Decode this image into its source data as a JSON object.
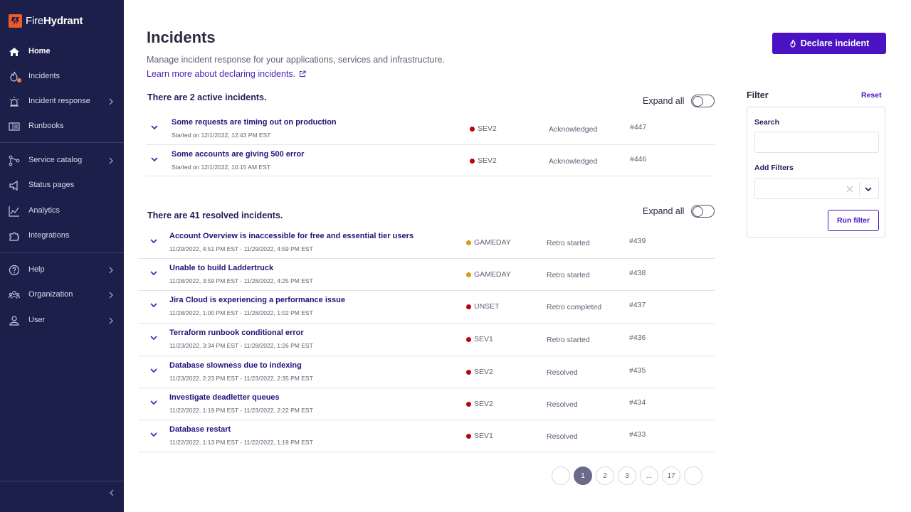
{
  "app": {
    "brand_light": "Fire",
    "brand_bold": "Hydrant",
    "accent_color": "#4a12c2",
    "sidebar_color": "#1b1f4a"
  },
  "sidebar": {
    "items": [
      {
        "label": "Home",
        "icon": "home-icon",
        "active": true
      },
      {
        "label": "Incidents",
        "icon": "fire-icon"
      },
      {
        "label": "Incident response",
        "icon": "siren-icon",
        "chevron": true
      },
      {
        "label": "Runbooks",
        "icon": "book-icon"
      },
      {
        "label": "Service catalog",
        "icon": "service-tree-icon",
        "chevron": true
      },
      {
        "label": "Status pages",
        "icon": "megaphone-icon"
      },
      {
        "label": "Analytics",
        "icon": "chart-line-icon"
      },
      {
        "label": "Integrations",
        "icon": "puzzle-icon"
      },
      {
        "label": "Help",
        "icon": "help-circle-icon",
        "chevron": true
      },
      {
        "label": "Organization",
        "icon": "people-icon",
        "chevron": true
      },
      {
        "label": "User",
        "icon": "user-icon",
        "chevron": true
      }
    ]
  },
  "header": {
    "title": "Incidents",
    "subtitle": "Manage incident response for your applications, services and infrastructure.",
    "learn_link": "Learn more about declaring incidents.",
    "declare_button": "Declare incident"
  },
  "active": {
    "heading": "There are 2 active incidents.",
    "expand_label": "Expand all",
    "rows": [
      {
        "title": "Some requests are timing out on production",
        "meta": "Started on 12/1/2022, 12:43 PM EST",
        "severity": "SEV2",
        "severity_color": "#c0000c",
        "status": "Acknowledged",
        "number": "#447"
      },
      {
        "title": "Some accounts are giving 500 error",
        "meta": "Started on 12/1/2022, 10:15 AM EST",
        "severity": "SEV2",
        "severity_color": "#c0000c",
        "status": "Acknowledged",
        "number": "#446"
      }
    ]
  },
  "resolved": {
    "heading": "There are 41 resolved incidents.",
    "expand_label": "Expand all",
    "rows": [
      {
        "title": "Account Overview is inaccessible for free and essential tier users",
        "meta": "11/29/2022, 4:51 PM EST - 11/29/2022, 4:59 PM EST",
        "severity": "GAMEDAY",
        "severity_color": "#d99a1e",
        "status": "Retro started",
        "number": "#439"
      },
      {
        "title": "Unable to build Laddertruck",
        "meta": "11/28/2022, 3:59 PM EST - 11/28/2022, 4:25 PM EST",
        "severity": "GAMEDAY",
        "severity_color": "#d99a1e",
        "status": "Retro started",
        "number": "#438"
      },
      {
        "title": "Jira Cloud is experiencing a performance issue",
        "meta": "11/28/2022, 1:00 PM EST - 11/28/2022, 1:02 PM EST",
        "severity": "UNSET",
        "severity_color": "#c0000c",
        "status": "Retro completed",
        "number": "#437"
      },
      {
        "title": "Terraform runbook conditional error",
        "meta": "11/23/2022, 3:34 PM EST - 11/28/2022, 1:26 PM EST",
        "severity": "SEV1",
        "severity_color": "#c0000c",
        "status": "Retro started",
        "number": "#436"
      },
      {
        "title": "Database slowness due to indexing",
        "meta": "11/23/2022, 2:23 PM EST - 11/23/2022, 2:35 PM EST",
        "severity": "SEV2",
        "severity_color": "#c0000c",
        "status": "Resolved",
        "number": "#435"
      },
      {
        "title": "Investigate deadletter queues",
        "meta": "11/22/2022, 1:19 PM EST - 11/23/2022, 2:22 PM EST",
        "severity": "SEV2",
        "severity_color": "#c0000c",
        "status": "Resolved",
        "number": "#434"
      },
      {
        "title": "Database restart",
        "meta": "11/22/2022, 1:13 PM EST - 11/22/2022, 1:19 PM EST",
        "severity": "SEV1",
        "severity_color": "#c0000c",
        "status": "Resolved",
        "number": "#433"
      }
    ]
  },
  "pagination": {
    "pages": [
      "1",
      "2",
      "3",
      "...",
      "17"
    ],
    "current": "1"
  },
  "filter": {
    "title": "Filter",
    "reset": "Reset",
    "search_label": "Search",
    "search_value": "",
    "add_filters_label": "Add Filters",
    "run_button": "Run filter"
  }
}
